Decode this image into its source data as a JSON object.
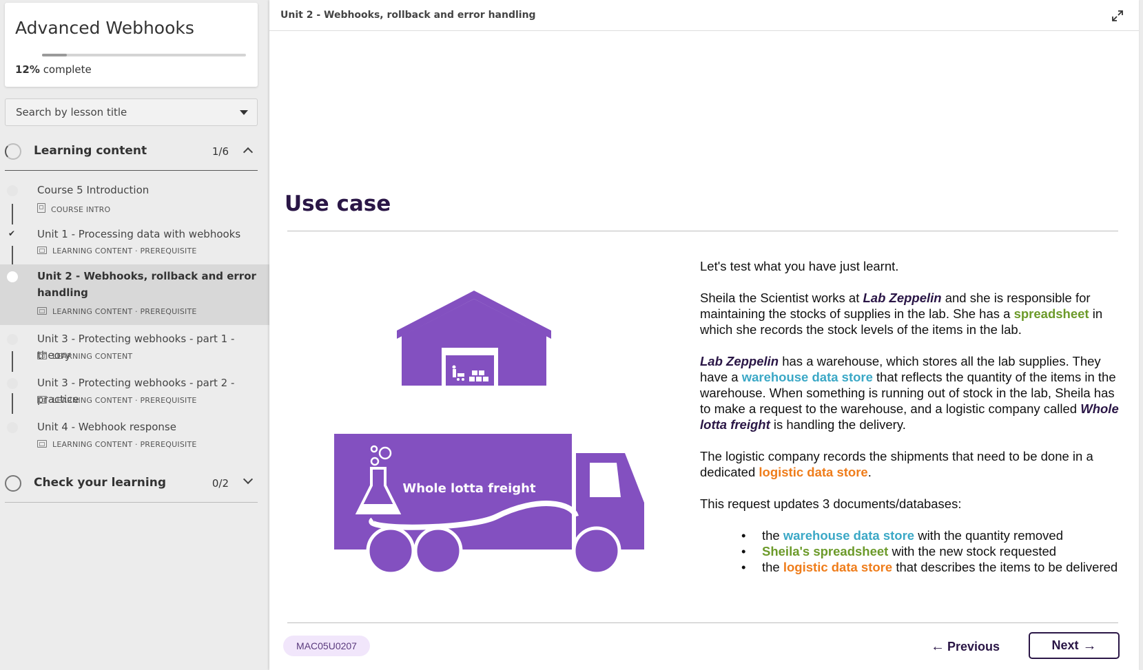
{
  "sidebar": {
    "course_title": "Advanced Webhooks",
    "progress_percent": "12%",
    "progress_suffix": "complete",
    "progress_fraction": 0.12,
    "search_placeholder": "Search by lesson title",
    "sections": [
      {
        "label": "Learning content",
        "count": "1/6",
        "expanded": true
      },
      {
        "label": "Check your learning",
        "count": "0/2",
        "expanded": false
      }
    ],
    "lessons": [
      {
        "title": "Course 5 Introduction",
        "meta": "COURSE INTRO",
        "icon": "document-icon",
        "status": "incomplete"
      },
      {
        "title": "Unit 1 - Processing data with webhooks",
        "meta": "LEARNING CONTENT · PREREQUISITE",
        "icon": "slides-icon",
        "status": "complete"
      },
      {
        "title": "Unit 2 - Webhooks, rollback and error handling",
        "meta": "LEARNING CONTENT · PREREQUISITE",
        "icon": "slides-icon",
        "status": "current"
      },
      {
        "title": "Unit 3 - Protecting webhooks - part 1 - theory",
        "meta": "LEARNING CONTENT",
        "icon": "slides-icon",
        "status": "incomplete"
      },
      {
        "title": "Unit 3 - Protecting webhooks - part 2 - practice",
        "meta": "LEARNING CONTENT · PREREQUISITE",
        "icon": "slides-icon",
        "status": "incomplete"
      },
      {
        "title": "Unit 4 - Webhook response",
        "meta": "LEARNING CONTENT · PREREQUISITE",
        "icon": "slides-icon",
        "status": "incomplete"
      }
    ]
  },
  "main": {
    "breadcrumb": "Unit 2 - Webhooks, rollback and error handling",
    "slide_title": "Use case",
    "truck_label": "Whole lotta freight",
    "text": {
      "p1": "Let's test what you have just learnt.",
      "p2_a": "Sheila the Scientist works at ",
      "p2_b": "Lab Zeppelin",
      "p2_c": " and she is responsible for maintaining the stocks of supplies in the lab. She has a ",
      "p2_d": "spreadsheet",
      "p2_e": " in which she records the stock levels of the items in the lab.",
      "p3_a": "Lab Zeppelin",
      "p3_b": " has a warehouse, which stores all the lab supplies. They have a ",
      "p3_c": "warehouse data store",
      "p3_d": " that reflects the quantity of the items in the warehouse. When something is running out of stock in the lab, Sheila has to make a request to the warehouse, and a logistic company called ",
      "p3_e": "Whole lotta freight",
      "p3_f": " is handling the delivery.",
      "p4_a": "The logistic company records the shipments that need to be done in a dedicated ",
      "p4_b": "logistic data store",
      "p4_c": ".",
      "p5": "This request updates 3 documents/databases:",
      "b1_a": "the ",
      "b1_b": "warehouse data store",
      "b1_c": " with the quantity removed",
      "b2_a": "Sheila's spreadsheet",
      "b2_b": " with the new stock requested",
      "b3_a": "the ",
      "b3_b": "logistic data store",
      "b3_c": " that describes the items to be delivered"
    },
    "footer": {
      "code": "MAC05U0207",
      "previous_label": "Previous",
      "next_label": "Next"
    }
  },
  "colors": {
    "brand_dark": "#2a1646",
    "illustration_purple": "#8350c0",
    "keyword_blue": "#3ba8c6",
    "keyword_green": "#6c9a2a",
    "keyword_orange": "#ef7d1b",
    "badge_bg": "#f1e6fb"
  }
}
